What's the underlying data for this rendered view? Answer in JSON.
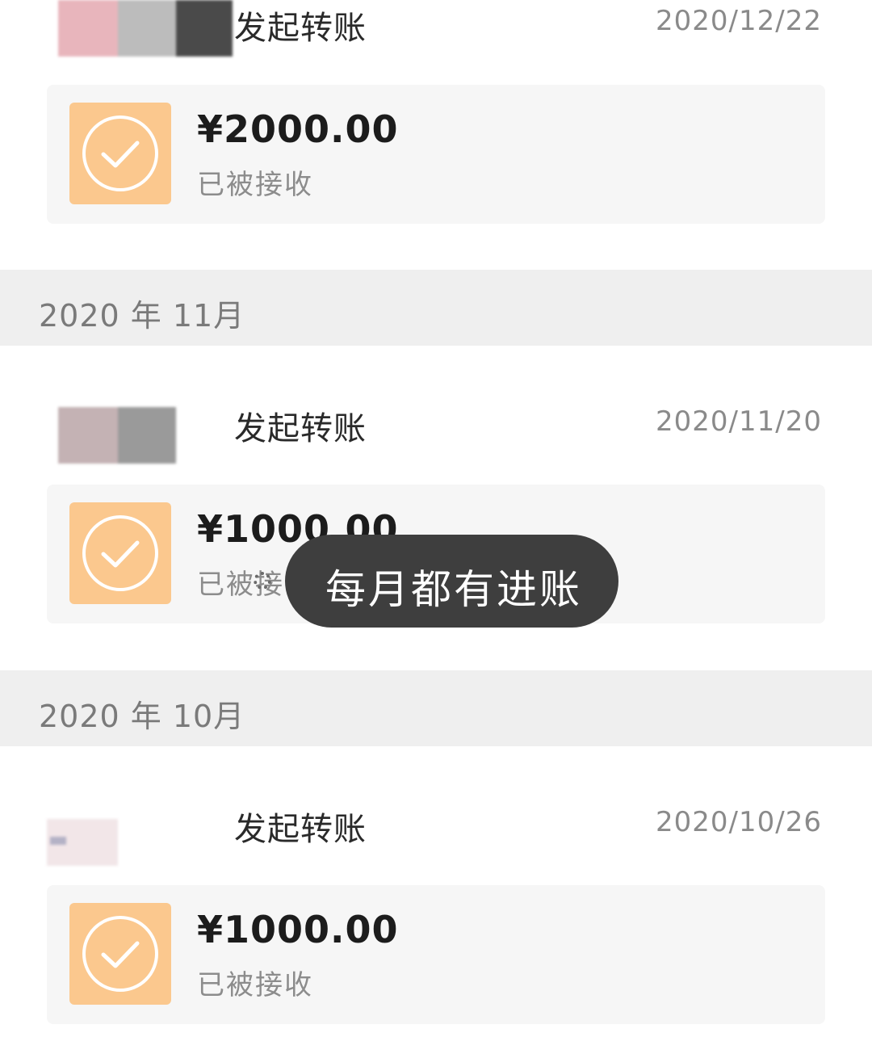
{
  "records": [
    {
      "title": "发起转账",
      "date": "2020/12/22",
      "amount": "¥2000.00",
      "status": "已被接收"
    },
    {
      "title": "发起转账",
      "date": "2020/11/20",
      "amount": "¥1000.00",
      "status": "已被接收"
    },
    {
      "title": "发起转账",
      "date": "2020/10/26",
      "amount": "¥1000.00",
      "status": "已被接收"
    }
  ],
  "month_headers": [
    "2020 年 11月",
    "2020 年 10月"
  ],
  "toast": {
    "text": "每月都有进账"
  },
  "colors": {
    "icon_background": "#fbc88e",
    "card_background": "#f6f6f6",
    "month_header_background": "#efefef",
    "toast_background": "#3e3e3e"
  },
  "icons": {
    "transfer_status": "check-circle-icon",
    "loading": "spinner-icon"
  }
}
